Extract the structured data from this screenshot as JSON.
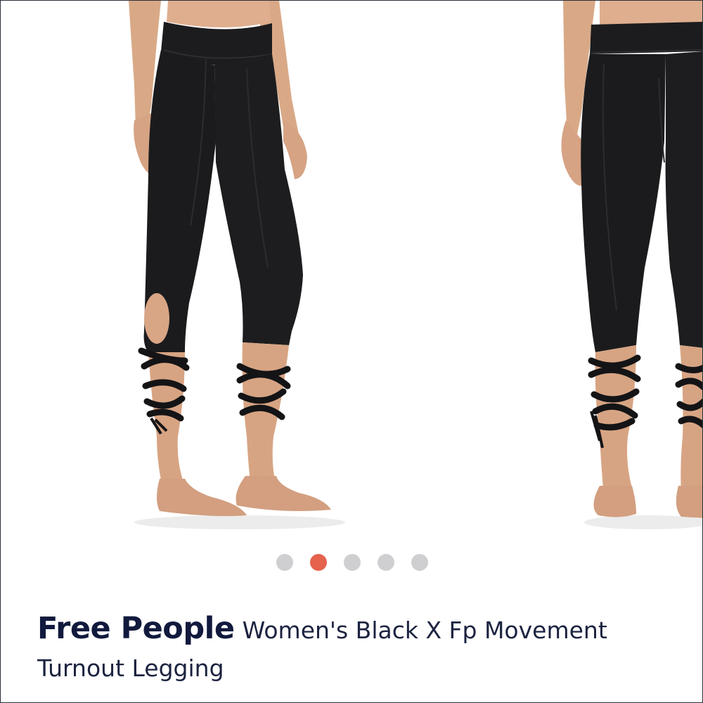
{
  "carousel": {
    "image_alt": "Black cropped leggings with wrap-tie ankles, front and back view",
    "slide_count": 5,
    "active_index": 1,
    "colors": {
      "active_dot": "#e5624d",
      "inactive_dot": "#cfcfd1"
    }
  },
  "product": {
    "brand": "Free People",
    "name": "Women's Black X Fp Movement Turnout Legging"
  }
}
